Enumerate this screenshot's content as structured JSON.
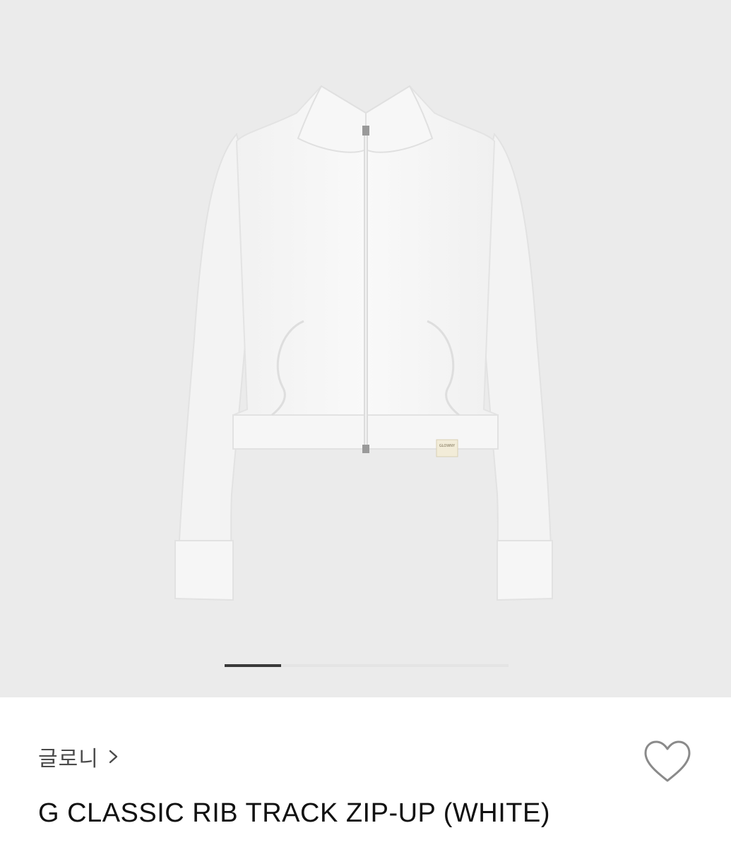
{
  "gallery": {
    "image_alt": "G CLASSIC RIB TRACK ZIP-UP (WHITE) product photo",
    "label_tag_text": "GLOWNY",
    "background_color": "#ebebeb",
    "pager": {
      "progress": 0.2,
      "track_color": "#e4e4e4",
      "fill_color": "#3a3a3a"
    }
  },
  "product": {
    "brand": "글로니",
    "brand_link_icon": "chevron-right-icon",
    "title": "G CLASSIC RIB TRACK ZIP-UP (WHITE)",
    "like_icon": "heart-outline-icon"
  }
}
